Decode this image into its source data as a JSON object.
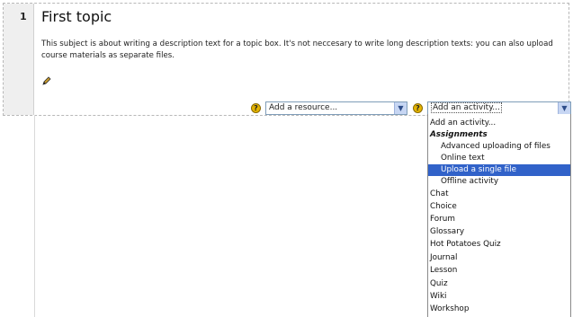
{
  "topic": {
    "number": "1",
    "title": "First topic",
    "description": "This subject is about writing a description text for a topic box. It's not neccesary to write long description texts: you can also upload course materials as separate files."
  },
  "icons": {
    "edit": "pencil-edit-icon",
    "help": "question-help-icon",
    "dropdown": "chevron-down-icon"
  },
  "help_glyph": "?",
  "dropdown_glyph": "▼",
  "resource_select": {
    "value": "Add a resource..."
  },
  "activity_select": {
    "value": "Add an activity..."
  },
  "activity_menu": {
    "items": [
      {
        "label": "Add an activity...",
        "kind": "main"
      },
      {
        "label": "Assignments",
        "kind": "group"
      },
      {
        "label": "Advanced uploading of files",
        "kind": "sub"
      },
      {
        "label": "Online text",
        "kind": "sub"
      },
      {
        "label": "Upload a single file",
        "kind": "sub",
        "selected": true
      },
      {
        "label": "Offline activity",
        "kind": "sub"
      },
      {
        "label": "Chat",
        "kind": "main"
      },
      {
        "label": "Choice",
        "kind": "main"
      },
      {
        "label": "Forum",
        "kind": "main"
      },
      {
        "label": "Glossary",
        "kind": "main"
      },
      {
        "label": "Hot Potatoes Quiz",
        "kind": "main"
      },
      {
        "label": "Journal",
        "kind": "main"
      },
      {
        "label": "Lesson",
        "kind": "main"
      },
      {
        "label": "Quiz",
        "kind": "main"
      },
      {
        "label": "Wiki",
        "kind": "main"
      },
      {
        "label": "Workshop",
        "kind": "main"
      }
    ]
  },
  "colors": {
    "selection": "#3162c9",
    "help_icon": "#e4b400",
    "select_border": "#7f9db9"
  }
}
